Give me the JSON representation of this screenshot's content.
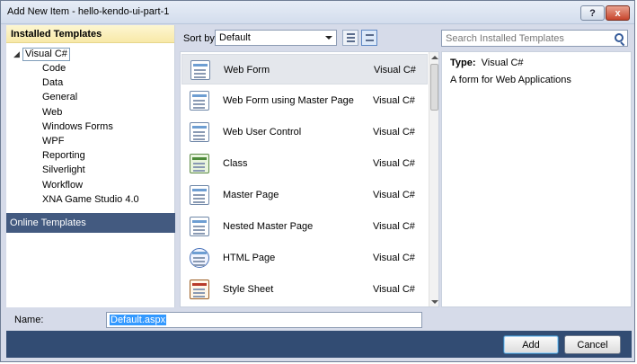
{
  "window": {
    "title": "Add New Item - hello-kendo-ui-part-1",
    "help_label": "?",
    "close_label": "x"
  },
  "sidebar": {
    "header": "Installed Templates",
    "root": {
      "arrow": "◢",
      "label": "Visual C#"
    },
    "items": [
      "Code",
      "Data",
      "General",
      "Web",
      "Windows Forms",
      "WPF",
      "Reporting",
      "Silverlight",
      "Workflow",
      "XNA Game Studio 4.0"
    ],
    "online": "Online Templates"
  },
  "toolbar": {
    "sort_label": "Sort by:",
    "sort_value": "Default",
    "search_placeholder": "Search Installed Templates"
  },
  "templates": [
    {
      "name": "Web Form",
      "lang": "Visual C#",
      "icon": "web-form-icon"
    },
    {
      "name": "Web Form using Master Page",
      "lang": "Visual C#",
      "icon": "web-form-master-icon"
    },
    {
      "name": "Web User Control",
      "lang": "Visual C#",
      "icon": "user-control-icon"
    },
    {
      "name": "Class",
      "lang": "Visual C#",
      "icon": "class-icon"
    },
    {
      "name": "Master Page",
      "lang": "Visual C#",
      "icon": "master-page-icon"
    },
    {
      "name": "Nested Master Page",
      "lang": "Visual C#",
      "icon": "nested-master-page-icon"
    },
    {
      "name": "HTML Page",
      "lang": "Visual C#",
      "icon": "html-page-icon"
    },
    {
      "name": "Style Sheet",
      "lang": "Visual C#",
      "icon": "style-sheet-icon"
    }
  ],
  "details": {
    "type_label": "Type:",
    "type_value": "Visual C#",
    "description": "A form for Web Applications"
  },
  "name_field": {
    "label": "Name:",
    "value": "Default.aspx"
  },
  "buttons": {
    "add": "Add",
    "cancel": "Cancel"
  },
  "colors": {
    "footer": "#324c73",
    "online_templates_bg": "#435a80",
    "header_bg": "#f8e9a8"
  }
}
